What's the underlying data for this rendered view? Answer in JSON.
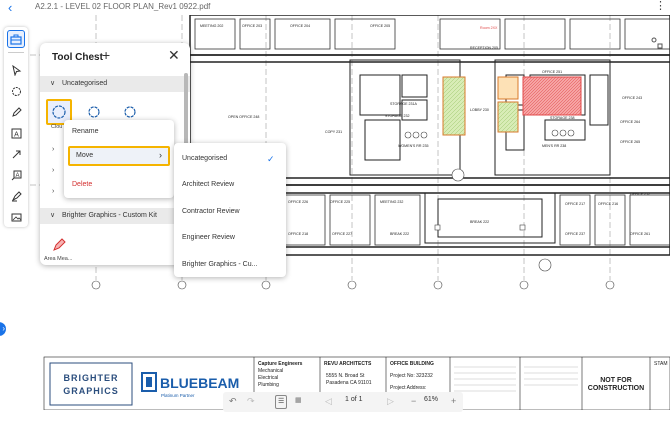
{
  "header": {
    "back_icon": "chevron-left-icon",
    "file_title": "A2.2.1 - LEVEL 02 FLOOR PLAN_Rev1 0922.pdf",
    "menu_icon": "kebab-icon"
  },
  "tool_chest": {
    "title": "Tool Chest",
    "sections": {
      "uncategorised": "Uncategorised",
      "brighter": "Brighter Graphics - Custom Kit"
    },
    "tool_caption": "Clou",
    "area_caption": "Area Mea..."
  },
  "context_menu": {
    "rename": "Rename",
    "move": "Move",
    "delete": "Delete"
  },
  "submenu": {
    "items": [
      "Uncategorised",
      "Architect Review",
      "Contractor Review",
      "Engineer Review",
      "Brighter Graphics - Cu..."
    ],
    "checked_index": 0
  },
  "bottom_toolbar": {
    "page_nav": "1 of 1",
    "zoom": "61%",
    "minus": "−",
    "plus": "+"
  },
  "title_block": {
    "logo1_line1": "BRIGHTER",
    "logo1_line2": "GRAPHICS",
    "logo2": "BLUEBEAM",
    "logo2_sub": "Platinum Partner",
    "consultant_name": "Capture Engineers",
    "consultant_lines": [
      "Mechanical",
      "Electrical",
      "Plumbing"
    ],
    "architect_name": "REVU ARCHITECTS",
    "architect_lines": [
      "5555 N. Broad St",
      "Pasadena CA 91101"
    ],
    "project_name": "OFFICE BUILDING",
    "project_no": "Project No: 323232",
    "project_address": "Project Address:",
    "status_line1": "NOT FOR",
    "status_line2": "CONSTRUCTION",
    "stamp_label": "STAM"
  },
  "rooms": [
    "MEETING 202",
    "OFFICE 203",
    "OFFICE 204",
    "OFFICE 205",
    "RECEPTION 205",
    "Room 2XX",
    "OPEN OFFICE 248",
    "COPY 231",
    "STORAGE 231A",
    "STORAGE 232",
    "WOMEN'S RR 235",
    "LOBBY 230",
    "STORAGE 238",
    "MEN'S RR 238",
    "OFFICE 243",
    "OFFICE 264",
    "OFFICE 265",
    "OFFICE 251",
    "OFFICE 228",
    "OFFICE 226",
    "OFFICE 225",
    "MEETING 232",
    "BREAK 222",
    "OFFICE 219",
    "OFFICE 220",
    "OFFICE 227",
    "OFFICE 218",
    "OFFICE 217",
    "OFFICE 216",
    "OFFICE 212",
    "OFFICE 237",
    "OFFICE 261",
    "BREAK 222",
    "STAIR 1",
    "STAIR 2"
  ],
  "colors": {
    "accent": "#1a73e8",
    "highlight": "#f5b400",
    "delete": "#d32f2f",
    "hatch_red": "#f26b6b",
    "hatch_green": "#b9e08f"
  }
}
